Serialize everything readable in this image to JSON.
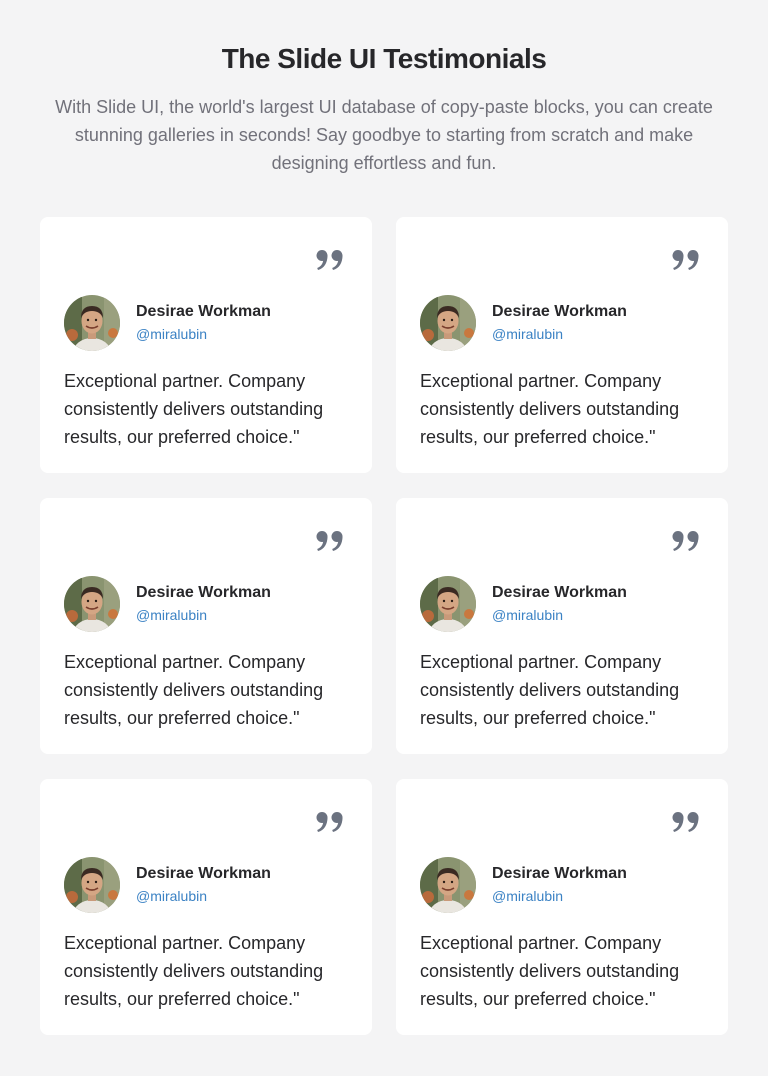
{
  "header": {
    "title": "The Slide UI Testimonials",
    "subtitle": "With Slide UI, the world's largest UI database of copy-paste blocks, you can create stunning galleries in seconds! Say goodbye to starting from scratch and make designing effortless and fun."
  },
  "testimonials": [
    {
      "name": "Desirae Workman",
      "handle": "@miralubin",
      "text": "Exceptional partner. Company consistently delivers outstanding results, our preferred choice.\"",
      "icon": "quote-icon"
    },
    {
      "name": "Desirae Workman",
      "handle": "@miralubin",
      "text": "Exceptional partner. Company consistently delivers outstanding results, our preferred choice.\"",
      "icon": "quote-icon"
    },
    {
      "name": "Desirae Workman",
      "handle": "@miralubin",
      "text": "Exceptional partner. Company consistently delivers outstanding results, our preferred choice.\"",
      "icon": "quote-icon"
    },
    {
      "name": "Desirae Workman",
      "handle": "@miralubin",
      "text": "Exceptional partner. Company consistently delivers outstanding results, our preferred choice.\"",
      "icon": "quote-icon"
    },
    {
      "name": "Desirae Workman",
      "handle": "@miralubin",
      "text": "Exceptional partner. Company consistently delivers outstanding results, our preferred choice.\"",
      "icon": "quote-icon"
    },
    {
      "name": "Desirae Workman",
      "handle": "@miralubin",
      "text": "Exceptional partner. Company consistently delivers outstanding results, our preferred choice.\"",
      "icon": "quote-icon"
    }
  ],
  "colors": {
    "background": "#f4f4f5",
    "card": "#ffffff",
    "title": "#27272a",
    "subtitle": "#71717a",
    "handle": "#3b82c4",
    "quote_icon": "#6b7280"
  }
}
